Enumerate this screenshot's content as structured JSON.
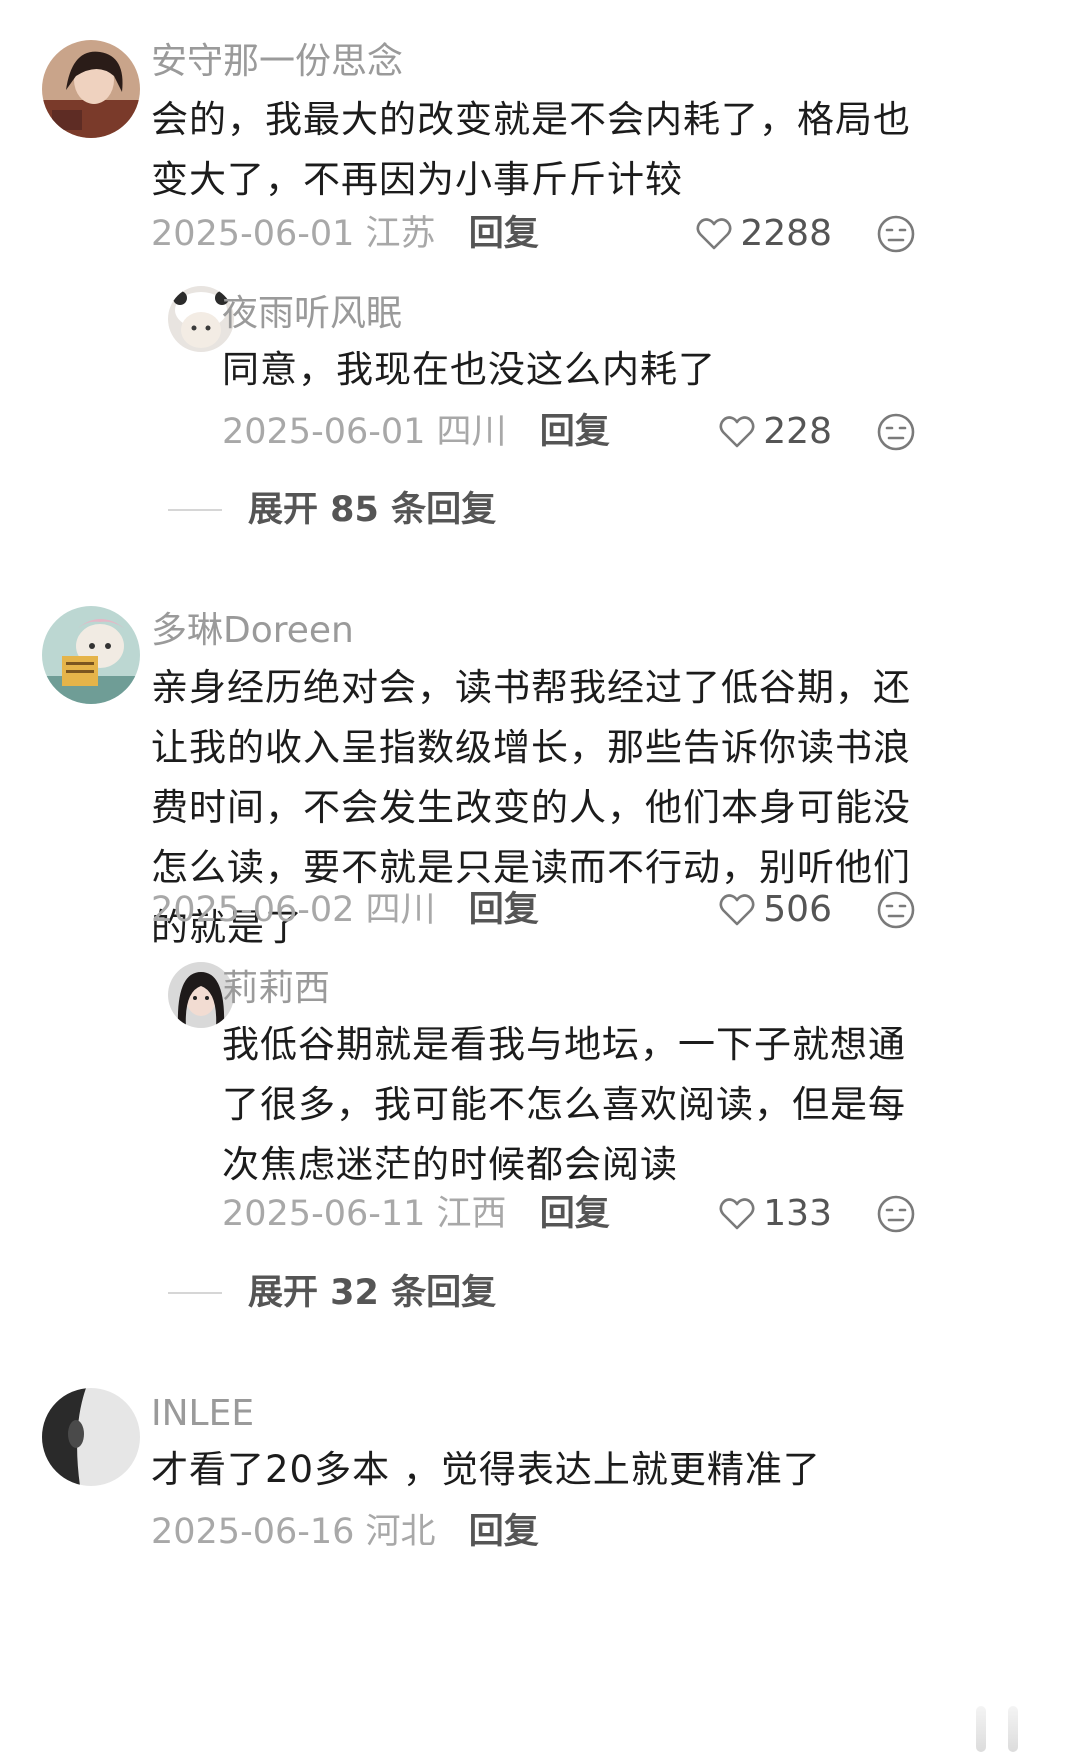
{
  "comments": [
    {
      "username": "安守那一份思念",
      "text": "会的，我最大的改变就是不会内耗了，格局也变大了，不再因为小事斤斤计较",
      "date": "2025-06-01",
      "location": "江苏",
      "reply_label": "回复",
      "likes": "2288",
      "replies": [
        {
          "username": "夜雨听风眠",
          "text": "同意，我现在也没这么内耗了",
          "date": "2025-06-01",
          "location": "四川",
          "reply_label": "回复",
          "likes": "228"
        }
      ],
      "expand_label": "展开 85 条回复"
    },
    {
      "username": "多琳Doreen",
      "text": "亲身经历绝对会，读书帮我经过了低谷期，还让我的收入呈指数级增长，那些告诉你读书浪费时间，不会发生改变的人，他们本身可能没怎么读，要不就是只是读而不行动，别听他们的就是了",
      "date": "2025-06-02",
      "location": "四川",
      "reply_label": "回复",
      "likes": "506",
      "replies": [
        {
          "username": "莉莉西",
          "text": "我低谷期就是看我与地坛，一下子就想通了很多，我可能不怎么喜欢阅读，但是每次焦虑迷茫的时候都会阅读",
          "date": "2025-06-11",
          "location": "江西",
          "reply_label": "回复",
          "likes": "133"
        }
      ],
      "expand_label": "展开 32 条回复"
    },
    {
      "username": "INLEE",
      "text": "才看了20多本 ，觉得表达上就更精准了",
      "date": "2025-06-16",
      "location": "河北",
      "reply_label": "回复"
    }
  ],
  "icons": {
    "like": "heart-outline-icon",
    "dislike": "neutral-face-icon"
  },
  "colors": {
    "username": "#9a9a9a",
    "meta": "#a8a8a8",
    "action": "#555555",
    "text": "#1c1c1c"
  }
}
